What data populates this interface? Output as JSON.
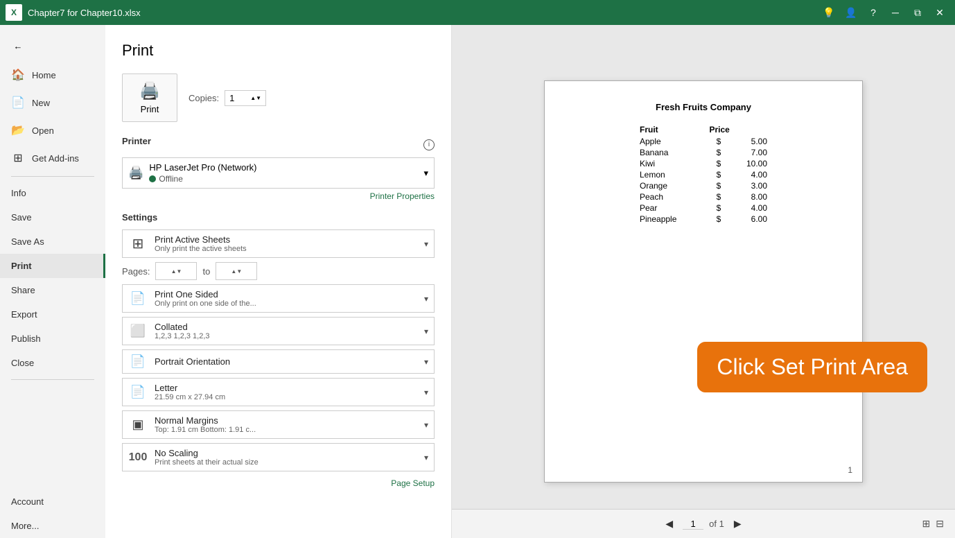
{
  "titleBar": {
    "logo": "X",
    "title": "Chapter7 for Chapter10.xlsx",
    "controls": {
      "lightbulb": "💡",
      "people": "👤",
      "help": "?",
      "minimize": "─",
      "restore": "⧉",
      "close": "✕"
    }
  },
  "sidebar": {
    "backIcon": "←",
    "items": [
      {
        "id": "home",
        "label": "Home",
        "icon": "🏠",
        "active": false
      },
      {
        "id": "new",
        "label": "New",
        "icon": "📄",
        "active": false
      },
      {
        "id": "open",
        "label": "Open",
        "icon": "📂",
        "active": false
      },
      {
        "id": "get-add-ins",
        "label": "Get Add-ins",
        "icon": "⊞",
        "active": false
      },
      {
        "id": "info",
        "label": "Info",
        "icon": "",
        "active": false
      },
      {
        "id": "save",
        "label": "Save",
        "icon": "",
        "active": false
      },
      {
        "id": "save-as",
        "label": "Save As",
        "icon": "",
        "active": false
      },
      {
        "id": "print",
        "label": "Print",
        "icon": "",
        "active": true
      },
      {
        "id": "share",
        "label": "Share",
        "icon": "",
        "active": false
      },
      {
        "id": "export",
        "label": "Export",
        "icon": "",
        "active": false
      },
      {
        "id": "publish",
        "label": "Publish",
        "icon": "",
        "active": false
      },
      {
        "id": "close",
        "label": "Close",
        "icon": "",
        "active": false
      }
    ],
    "bottomItems": [
      {
        "id": "account",
        "label": "Account",
        "active": false
      },
      {
        "id": "more",
        "label": "More...",
        "active": false
      }
    ]
  },
  "print": {
    "title": "Print",
    "printButton": "Print",
    "copiesLabel": "Copies:",
    "copiesValue": "1",
    "printer": {
      "sectionLabel": "Printer",
      "name": "HP LaserJet Pro (Network)",
      "status": "Offline",
      "propertiesLink": "Printer Properties"
    },
    "settings": {
      "sectionLabel": "Settings",
      "items": [
        {
          "id": "print-scope",
          "main": "Print Active Sheets",
          "sub": "Only print the active sheets"
        },
        {
          "id": "pages",
          "main": "",
          "sub": ""
        },
        {
          "id": "one-sided",
          "main": "Print One Sided",
          "sub": "Only print on one side of the..."
        },
        {
          "id": "collated",
          "main": "Collated",
          "sub": "1,2,3    1,2,3    1,2,3"
        },
        {
          "id": "orientation",
          "main": "Portrait Orientation",
          "sub": ""
        },
        {
          "id": "paper",
          "main": "Letter",
          "sub": "21.59 cm x 27.94 cm"
        },
        {
          "id": "margins",
          "main": "Normal Margins",
          "sub": "Top: 1.91 cm Bottom: 1.91 c..."
        },
        {
          "id": "scaling",
          "main": "No Scaling",
          "sub": "Print sheets at their actual size"
        }
      ]
    },
    "pagesLabel": "Pages:",
    "pagesTo": "to",
    "pageSetupLink": "Page Setup"
  },
  "preview": {
    "companyName": "Fresh Fruits Company",
    "tableHeaders": [
      "Fruit",
      "Price"
    ],
    "tableRows": [
      [
        "Apple",
        "$",
        "5.00"
      ],
      [
        "Banana",
        "$",
        "7.00"
      ],
      [
        "Kiwi",
        "$",
        "10.00"
      ],
      [
        "Lemon",
        "$",
        "4.00"
      ],
      [
        "Orange",
        "$",
        "3.00"
      ],
      [
        "Peach",
        "$",
        "8.00"
      ],
      [
        "Pear",
        "$",
        "4.00"
      ],
      [
        "Pineapple",
        "$",
        "6.00"
      ]
    ],
    "annotation": "Click Set Print Area",
    "pageNumber": "1",
    "pageOf": "of 1"
  },
  "colors": {
    "accent": "#1e7145",
    "orange": "#e8720c"
  }
}
